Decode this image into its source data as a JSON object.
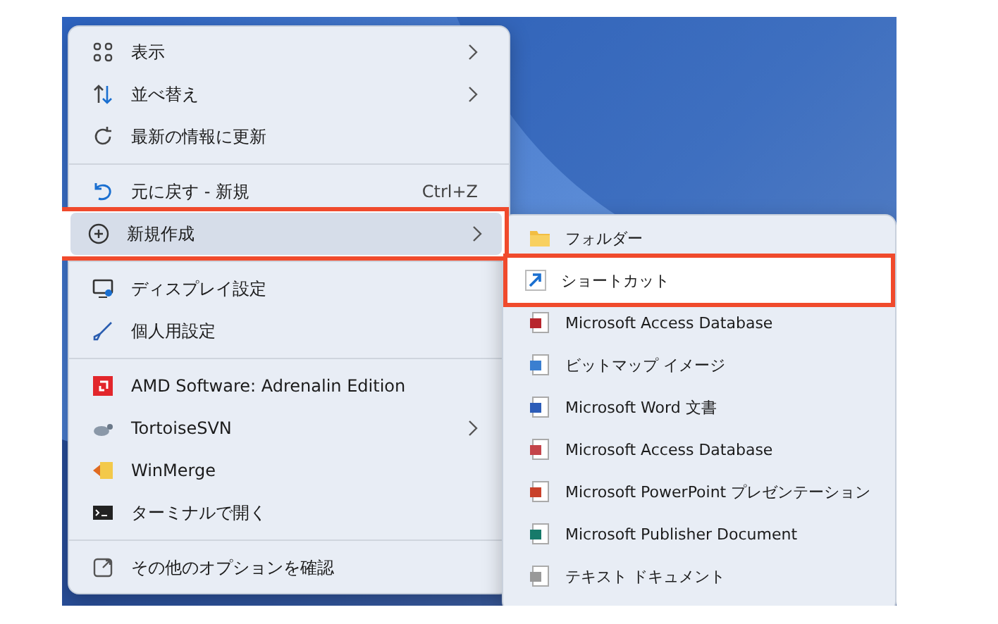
{
  "context_menu": {
    "items": [
      {
        "kind": "item",
        "label": "表示",
        "submenu": true,
        "selected": false,
        "highlighted": false
      },
      {
        "kind": "item",
        "label": "並べ替え",
        "submenu": true,
        "selected": false,
        "highlighted": false
      },
      {
        "kind": "item",
        "label": "最新の情報に更新",
        "submenu": false,
        "selected": false,
        "highlighted": false
      },
      {
        "kind": "separator"
      },
      {
        "kind": "item",
        "label": "元に戻す - 新規",
        "shortcut": "Ctrl+Z",
        "submenu": false,
        "selected": false,
        "highlighted": false
      },
      {
        "kind": "item",
        "label": "新規作成",
        "submenu": true,
        "selected": true,
        "highlighted": true
      },
      {
        "kind": "separator"
      },
      {
        "kind": "item",
        "label": "ディスプレイ設定",
        "submenu": false,
        "selected": false,
        "highlighted": false
      },
      {
        "kind": "item",
        "label": "個人用設定",
        "submenu": false,
        "selected": false,
        "highlighted": false
      },
      {
        "kind": "separator"
      },
      {
        "kind": "item",
        "label": "AMD Software: Adrenalin Edition",
        "submenu": false,
        "selected": false,
        "highlighted": false
      },
      {
        "kind": "item",
        "label": "TortoiseSVN",
        "submenu": true,
        "selected": false,
        "highlighted": false
      },
      {
        "kind": "item",
        "label": "WinMerge",
        "submenu": false,
        "selected": false,
        "highlighted": false
      },
      {
        "kind": "item",
        "label": "ターミナルで開く",
        "submenu": false,
        "selected": false,
        "highlighted": false
      },
      {
        "kind": "separator"
      },
      {
        "kind": "item",
        "label": "その他のオプションを確認",
        "submenu": false,
        "selected": false,
        "highlighted": false
      }
    ]
  },
  "new_submenu": {
    "items": [
      {
        "label": "フォルダー",
        "highlighted": false
      },
      {
        "label": "ショートカット",
        "highlighted": true
      },
      {
        "label": "Microsoft Access Database",
        "highlighted": false
      },
      {
        "label": "ビットマップ イメージ",
        "highlighted": false
      },
      {
        "label": "Microsoft Word 文書",
        "highlighted": false
      },
      {
        "label": "Microsoft Access Database",
        "highlighted": false
      },
      {
        "label": "Microsoft PowerPoint プレゼンテーション",
        "highlighted": false
      },
      {
        "label": "Microsoft Publisher Document",
        "highlighted": false
      },
      {
        "label": "テキスト ドキュメント",
        "highlighted": false
      }
    ]
  }
}
